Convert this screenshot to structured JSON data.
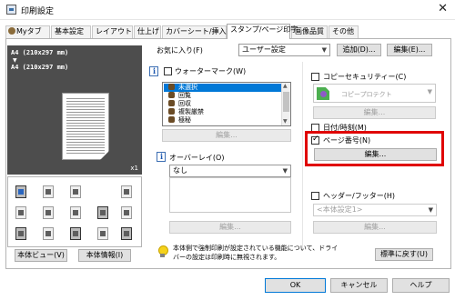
{
  "window": {
    "title": "印刷設定",
    "close_glyph": "✕"
  },
  "tabs": [
    {
      "label": "Myタブ"
    },
    {
      "label": "基本設定"
    },
    {
      "label": "レイアウト"
    },
    {
      "label": "仕上げ"
    },
    {
      "label": "カバーシート/挿入紙"
    },
    {
      "label": "スタンプ/ページ印字"
    },
    {
      "label": "画像品質"
    },
    {
      "label": "その他"
    }
  ],
  "active_tab": "スタンプ/ページ印字",
  "preview": {
    "line1": "A4 (210x297 mm)",
    "arrow": "▼",
    "line2": "A4 (210x297 mm)",
    "copies": "x1"
  },
  "left_buttons": {
    "printer_view": "本体ビュー(V)",
    "printer_info": "本体情報(I)"
  },
  "favorites": {
    "label": "お気に入り(F)",
    "value": "ユーザー設定",
    "add_button": "追加(D)...",
    "edit_button": "編集(E)..."
  },
  "watermark": {
    "label": "ウォーターマーク(W)",
    "checked": false,
    "items": [
      "未選択",
      "回覧",
      "回収",
      "複製厳禁",
      "極秘"
    ],
    "selected_index": 0,
    "edit_button": "編集..."
  },
  "overlay": {
    "label": "オーバーレイ(O)",
    "value": "なし",
    "edit_button": "編集..."
  },
  "copy_security": {
    "label": "コピーセキュリティー(C)",
    "checked": false,
    "value": "コピープロテクト",
    "edit_button": "編集..."
  },
  "date_time": {
    "label": "日付/時刻(M)",
    "checked": false
  },
  "page_number": {
    "label": "ページ番号(N)",
    "checked": true,
    "edit_button": "編集..."
  },
  "header_footer": {
    "label": "ヘッダー/フッター(H)",
    "checked": false,
    "value": "<本体設定1>",
    "edit_button": "編集..."
  },
  "info_message": {
    "line1": "本体側で強制印刷が設定されている機能について、ドライ",
    "line2": "バーの設定は印刷時に無視されます。"
  },
  "reset_button": "標準に戻す(U)",
  "footer": {
    "ok": "OK",
    "cancel": "キャンセル",
    "help": "ヘルプ"
  },
  "colors": {
    "highlight": "#e00000",
    "selection": "#0078d7"
  }
}
